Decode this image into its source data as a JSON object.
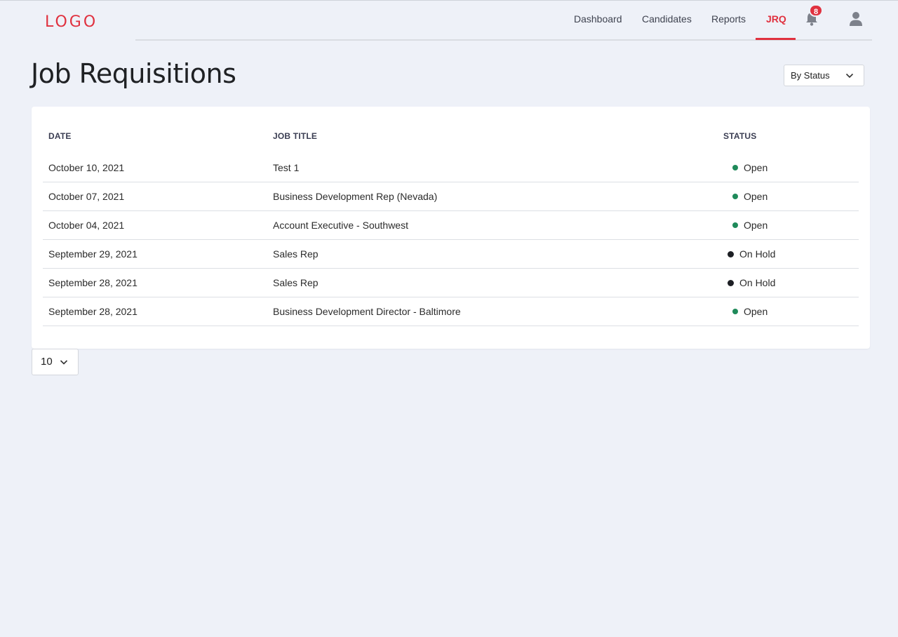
{
  "logo": "LOGO",
  "nav": {
    "items": [
      {
        "label": "Dashboard"
      },
      {
        "label": "Candidates"
      },
      {
        "label": "Reports"
      },
      {
        "label": "JRQ",
        "active": true
      }
    ],
    "notifications_count": "8",
    "icons": [
      "bell-icon",
      "user-icon"
    ]
  },
  "page": {
    "title": "Job Requisitions",
    "filter_label": "By Status"
  },
  "table": {
    "headers": {
      "date": "DATE",
      "job_title": "JOB TITLE",
      "status": "STATUS"
    },
    "rows": [
      {
        "date": "October 10, 2021",
        "title": "Test 1",
        "status": "Open"
      },
      {
        "date": "October 07, 2021",
        "title": "Business Development Rep (Nevada)",
        "status": "Open"
      },
      {
        "date": "October 04, 2021",
        "title": "Account Executive - Southwest",
        "status": "Open"
      },
      {
        "date": "September 29, 2021",
        "title": "Sales Rep",
        "status": "On Hold"
      },
      {
        "date": "September 28, 2021",
        "title": "Sales Rep",
        "status": "On Hold"
      },
      {
        "date": "September 28, 2021",
        "title": "Business Development Director - Baltimore",
        "status": "Open"
      }
    ]
  },
  "pagination": {
    "page_size": "10"
  },
  "colors": {
    "accent": "#e0313f",
    "open": "#1f8a5a",
    "hold": "#1d1f24",
    "background": "#eef1f8"
  }
}
